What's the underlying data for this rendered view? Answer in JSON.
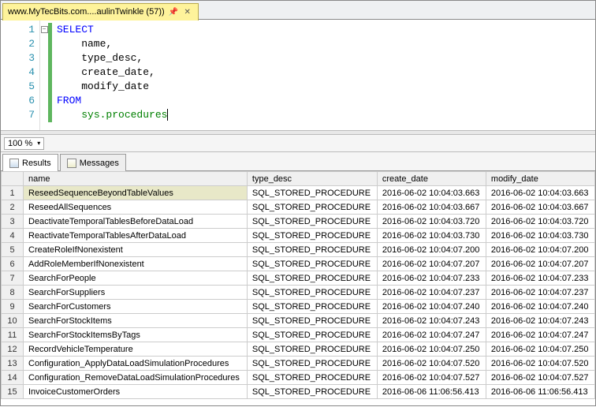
{
  "tab": {
    "title": "www.MyTecBits.com....aulinTwinkle (57))"
  },
  "editor": {
    "lines": [
      {
        "n": "1",
        "indent": "",
        "tokens": [
          {
            "t": "SELECT",
            "c": "kw"
          }
        ]
      },
      {
        "n": "2",
        "indent": "    ",
        "tokens": [
          {
            "t": "name",
            "c": ""
          },
          {
            "t": ",",
            "c": ""
          }
        ]
      },
      {
        "n": "3",
        "indent": "    ",
        "tokens": [
          {
            "t": "type_desc",
            "c": ""
          },
          {
            "t": ",",
            "c": ""
          }
        ]
      },
      {
        "n": "4",
        "indent": "    ",
        "tokens": [
          {
            "t": "create_date",
            "c": ""
          },
          {
            "t": ",",
            "c": ""
          }
        ]
      },
      {
        "n": "5",
        "indent": "    ",
        "tokens": [
          {
            "t": "modify_date",
            "c": ""
          }
        ]
      },
      {
        "n": "6",
        "indent": "",
        "tokens": [
          {
            "t": "FROM",
            "c": "kw"
          }
        ]
      },
      {
        "n": "7",
        "indent": "    ",
        "tokens": [
          {
            "t": "sys.procedures",
            "c": "obj"
          },
          {
            "t": " ",
            "c": "cursor"
          }
        ]
      }
    ]
  },
  "zoom": {
    "value": "100 %"
  },
  "result_tabs": {
    "results": "Results",
    "messages": "Messages"
  },
  "columns": [
    "name",
    "type_desc",
    "create_date",
    "modify_date"
  ],
  "rows": [
    {
      "n": "1",
      "name": "ReseedSequenceBeyondTableValues",
      "type_desc": "SQL_STORED_PROCEDURE",
      "create_date": "2016-06-02 10:04:03.663",
      "modify_date": "2016-06-02 10:04:03.663"
    },
    {
      "n": "2",
      "name": "ReseedAllSequences",
      "type_desc": "SQL_STORED_PROCEDURE",
      "create_date": "2016-06-02 10:04:03.667",
      "modify_date": "2016-06-02 10:04:03.667"
    },
    {
      "n": "3",
      "name": "DeactivateTemporalTablesBeforeDataLoad",
      "type_desc": "SQL_STORED_PROCEDURE",
      "create_date": "2016-06-02 10:04:03.720",
      "modify_date": "2016-06-02 10:04:03.720"
    },
    {
      "n": "4",
      "name": "ReactivateTemporalTablesAfterDataLoad",
      "type_desc": "SQL_STORED_PROCEDURE",
      "create_date": "2016-06-02 10:04:03.730",
      "modify_date": "2016-06-02 10:04:03.730"
    },
    {
      "n": "5",
      "name": "CreateRoleIfNonexistent",
      "type_desc": "SQL_STORED_PROCEDURE",
      "create_date": "2016-06-02 10:04:07.200",
      "modify_date": "2016-06-02 10:04:07.200"
    },
    {
      "n": "6",
      "name": "AddRoleMemberIfNonexistent",
      "type_desc": "SQL_STORED_PROCEDURE",
      "create_date": "2016-06-02 10:04:07.207",
      "modify_date": "2016-06-02 10:04:07.207"
    },
    {
      "n": "7",
      "name": "SearchForPeople",
      "type_desc": "SQL_STORED_PROCEDURE",
      "create_date": "2016-06-02 10:04:07.233",
      "modify_date": "2016-06-02 10:04:07.233"
    },
    {
      "n": "8",
      "name": "SearchForSuppliers",
      "type_desc": "SQL_STORED_PROCEDURE",
      "create_date": "2016-06-02 10:04:07.237",
      "modify_date": "2016-06-02 10:04:07.237"
    },
    {
      "n": "9",
      "name": "SearchForCustomers",
      "type_desc": "SQL_STORED_PROCEDURE",
      "create_date": "2016-06-02 10:04:07.240",
      "modify_date": "2016-06-02 10:04:07.240"
    },
    {
      "n": "10",
      "name": "SearchForStockItems",
      "type_desc": "SQL_STORED_PROCEDURE",
      "create_date": "2016-06-02 10:04:07.243",
      "modify_date": "2016-06-02 10:04:07.243"
    },
    {
      "n": "11",
      "name": "SearchForStockItemsByTags",
      "type_desc": "SQL_STORED_PROCEDURE",
      "create_date": "2016-06-02 10:04:07.247",
      "modify_date": "2016-06-02 10:04:07.247"
    },
    {
      "n": "12",
      "name": "RecordVehicleTemperature",
      "type_desc": "SQL_STORED_PROCEDURE",
      "create_date": "2016-06-02 10:04:07.250",
      "modify_date": "2016-06-02 10:04:07.250"
    },
    {
      "n": "13",
      "name": "Configuration_ApplyDataLoadSimulationProcedures",
      "type_desc": "SQL_STORED_PROCEDURE",
      "create_date": "2016-06-02 10:04:07.520",
      "modify_date": "2016-06-02 10:04:07.520"
    },
    {
      "n": "14",
      "name": "Configuration_RemoveDataLoadSimulationProcedures",
      "type_desc": "SQL_STORED_PROCEDURE",
      "create_date": "2016-06-02 10:04:07.527",
      "modify_date": "2016-06-02 10:04:07.527"
    },
    {
      "n": "15",
      "name": "InvoiceCustomerOrders",
      "type_desc": "SQL_STORED_PROCEDURE",
      "create_date": "2016-06-06 11:06:56.413",
      "modify_date": "2016-06-06 11:06:56.413"
    }
  ]
}
